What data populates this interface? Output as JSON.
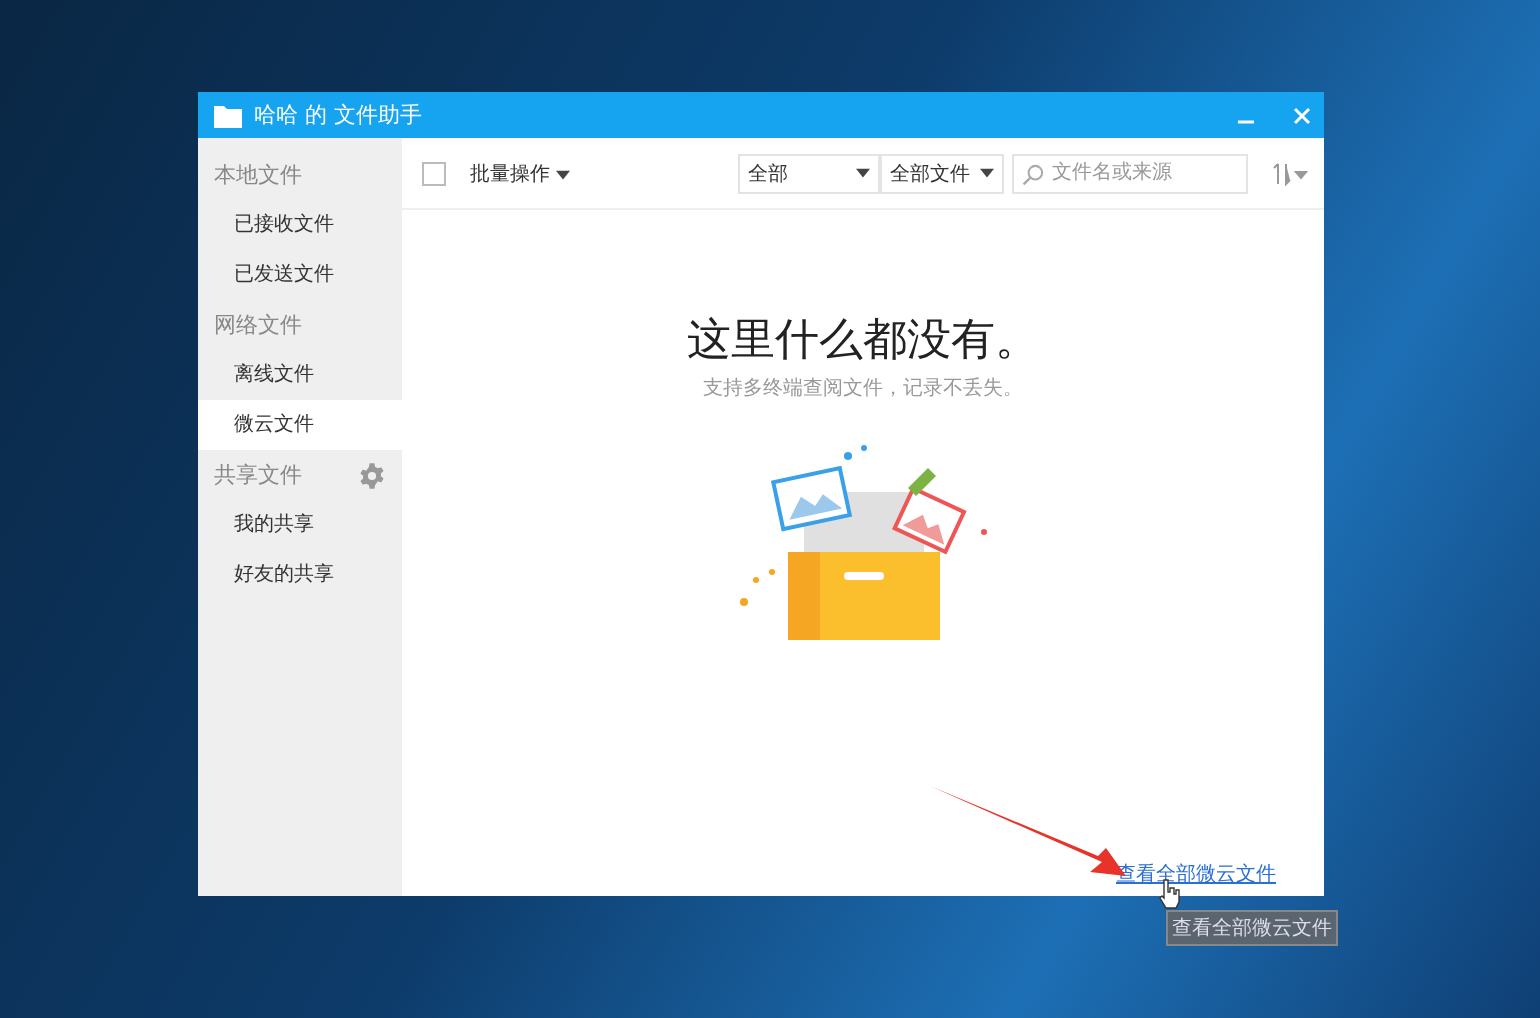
{
  "window": {
    "title": "哈哈 的 文件助手"
  },
  "sidebar": {
    "sections": [
      {
        "label": "本地文件",
        "items": [
          {
            "label": "已接收文件",
            "selected": false
          },
          {
            "label": "已发送文件",
            "selected": false
          }
        ]
      },
      {
        "label": "网络文件",
        "items": [
          {
            "label": "离线文件",
            "selected": false
          },
          {
            "label": "微云文件",
            "selected": true
          }
        ]
      },
      {
        "label": "共享文件",
        "settings": true,
        "items": [
          {
            "label": "我的共享",
            "selected": false
          },
          {
            "label": "好友的共享",
            "selected": false
          }
        ]
      }
    ]
  },
  "toolbar": {
    "select_all": {
      "checked": false
    },
    "batch_menu": "批量操作",
    "filter_1": "全部",
    "filter_2": "全部文件",
    "search": {
      "placeholder": "文件名或来源"
    }
  },
  "empty_state": {
    "title": "这里什么都没有。",
    "subtitle": "支持多终端查阅文件，记录不丢失。"
  },
  "link": "查看全部微云文件",
  "tooltip": "查看全部微云文件"
}
